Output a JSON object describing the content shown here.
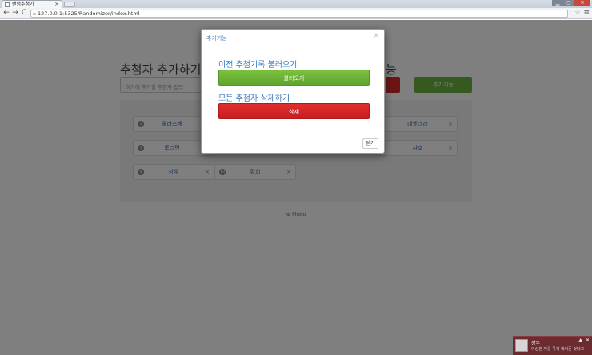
{
  "browser": {
    "tab_title": "랜덤추첨기",
    "tab_close": "×",
    "address": "127.0.0.1:5325/Randomizer/index.html",
    "back": "←",
    "forward": "→",
    "reload": "C",
    "star": "☆",
    "menu": "≡",
    "win_min": "▁",
    "win_max": "▢",
    "win_close": "✕"
  },
  "page": {
    "title": "추첨자 추가하기",
    "title_right": "능",
    "input_placeholder": "여기에 추가할 추첨자 입력",
    "extra_button": "추가기능",
    "footer": "⚙ Photo"
  },
  "participants": [
    {
      "index": "1",
      "name": "울라스베",
      "x": "×"
    },
    {
      "index": "",
      "name": "데엣데레",
      "x": "×"
    },
    {
      "index": "3",
      "name": "토리편",
      "x": "×"
    },
    {
      "index": "",
      "name": "사호",
      "x": "×"
    },
    {
      "index": "9",
      "name": "상우",
      "x": "×"
    },
    {
      "index": "10",
      "name": "황희",
      "x": "×"
    }
  ],
  "modal": {
    "title": "추가기능",
    "close_x": "×",
    "load_heading": "이전 추첨기록 불러오기",
    "load_button": "불러오기",
    "delete_heading": "모든 추첨자 삭제하기",
    "delete_button": "삭제",
    "close_button": "닫기"
  },
  "notification": {
    "title": "상우",
    "body": "이상한 자를 꼭꺼 애이존 것다고",
    "pin": "▲",
    "close": "✕"
  },
  "colors": {
    "accent_blue": "#3a7bbf",
    "green": "#6db33f",
    "red": "#d9262b",
    "toast": "#6b2b2f"
  }
}
